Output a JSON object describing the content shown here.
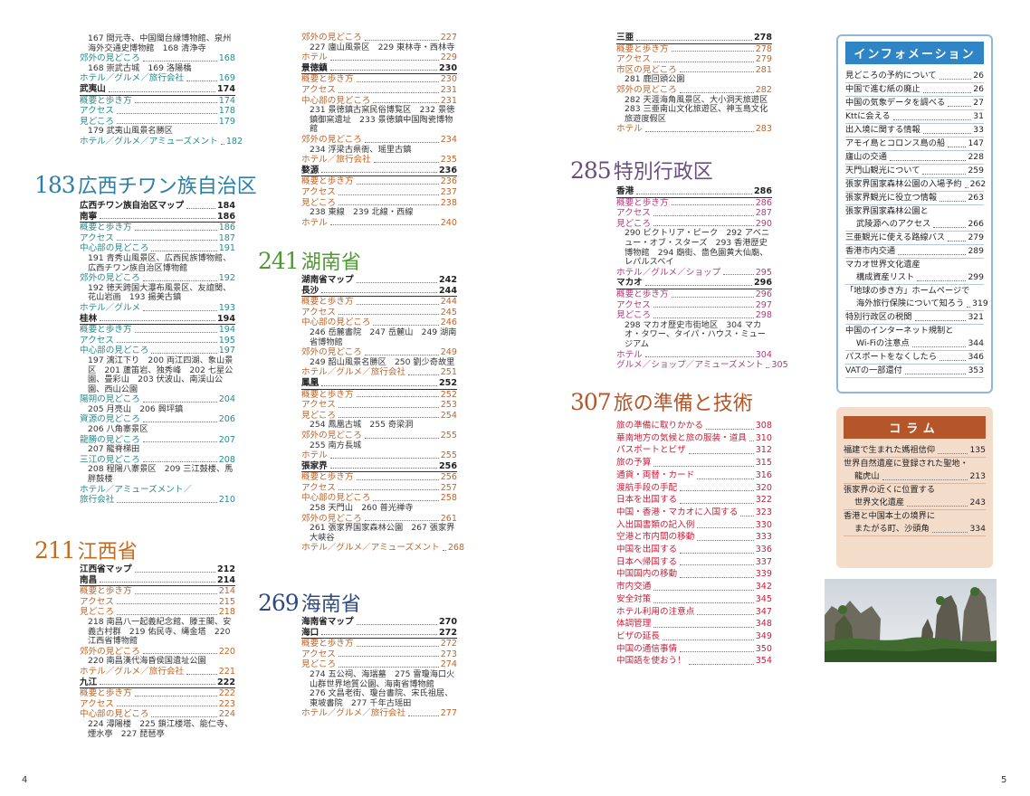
{
  "colA": [
    {
      "t": "167 開元寺、中国閩台縁博物館、泉州海外交通史博物館　168 清浄寺",
      "p": "",
      "c": "sub"
    },
    {
      "t": "郊外の見どころ",
      "p": "168",
      "c": "g"
    },
    {
      "t": "168 崇武古城　169 洛陽橋",
      "p": "",
      "c": "sub"
    },
    {
      "t": "ホテル／グルメ／旅行会社",
      "p": "169",
      "c": "g"
    },
    {
      "t": "武夷山",
      "p": "174",
      "c": "b rl"
    },
    {
      "t": "概要と歩き方",
      "p": "174",
      "c": "g"
    },
    {
      "t": "アクセス",
      "p": "178",
      "c": "g"
    },
    {
      "t": "見どころ",
      "p": "179",
      "c": "g"
    },
    {
      "t": "179 武夷山風景名勝区",
      "p": "",
      "c": "sub"
    },
    {
      "t": "ホテル／グルメ／アミューズメント",
      "p": "182",
      "c": "g"
    }
  ],
  "colB": [
    {
      "t": "広西チワン族自治区マップ",
      "p": "184",
      "c": "b"
    },
    {
      "t": "南寧",
      "p": "186",
      "c": "b rl"
    },
    {
      "t": "概要と歩き方",
      "p": "186",
      "c": "g"
    },
    {
      "t": "アクセス",
      "p": "187",
      "c": "g"
    },
    {
      "t": "中心部の見どころ",
      "p": "191",
      "c": "g"
    },
    {
      "t": "191 青秀山風景区、広西民族博物館、広西チワン族自治区博物館",
      "p": "",
      "c": "sub"
    },
    {
      "t": "郊外の見どころ",
      "p": "192",
      "c": "g"
    },
    {
      "t": "192 徳天跨国大瀑布風景区、友誼関、花山岩画　193 揚美古鎮",
      "p": "",
      "c": "sub"
    },
    {
      "t": "ホテル／グルメ",
      "p": "193",
      "c": "g"
    },
    {
      "t": "桂林",
      "p": "194",
      "c": "b rl"
    },
    {
      "t": "概要と歩き方",
      "p": "194",
      "c": "g"
    },
    {
      "t": "アクセス",
      "p": "195",
      "c": "g"
    },
    {
      "t": "中心部の見どころ",
      "p": "197",
      "c": "g"
    },
    {
      "t": "197 漓江下り　200 両江四湖、象山景区　201 蘆笛岩、独秀峰　202 七星公園、畳彩山　203 伏波山、南渓山公園、西山公園",
      "p": "",
      "c": "sub"
    },
    {
      "t": "陽朔の見どころ",
      "p": "204",
      "c": "g"
    },
    {
      "t": "205 月亮山　206 興坪鎮",
      "p": "",
      "c": "sub"
    },
    {
      "t": "資源の見どころ",
      "p": "206",
      "c": "g"
    },
    {
      "t": "206 八角寨景区",
      "p": "",
      "c": "sub"
    },
    {
      "t": "龍勝の見どころ",
      "p": "207",
      "c": "g"
    },
    {
      "t": "207 龍脊梯田",
      "p": "",
      "c": "sub"
    },
    {
      "t": "三江の見どころ",
      "p": "208",
      "c": "g"
    },
    {
      "t": "208 程陽八寨景区　209 三江鼓楼、馬胖鼓楼",
      "p": "",
      "c": "sub"
    },
    {
      "t": "ホテル／アミューズメント／",
      "p": "",
      "c": "g"
    },
    {
      "t": "旅行会社",
      "p": "210",
      "c": "g ind"
    }
  ],
  "colC": [
    {
      "t": "江西省マップ",
      "p": "212",
      "c": "b"
    },
    {
      "t": "南昌",
      "p": "214",
      "c": "b rl"
    },
    {
      "t": "概要と歩き方",
      "p": "214",
      "c": "o"
    },
    {
      "t": "アクセス",
      "p": "215",
      "c": "o"
    },
    {
      "t": "見どころ",
      "p": "218",
      "c": "o"
    },
    {
      "t": "218 南昌八一起義紀念館、滕王閣、安義古村群　219 佑民寺、縄金塔　220 江西省博物館",
      "p": "",
      "c": "sub"
    },
    {
      "t": "郊外の見どころ",
      "p": "220",
      "c": "o"
    },
    {
      "t": "220 南昌漢代海昏侯国遺址公園",
      "p": "",
      "c": "sub"
    },
    {
      "t": "ホテル／グルメ／旅行会社",
      "p": "221",
      "c": "o"
    },
    {
      "t": "九江",
      "p": "222",
      "c": "b rl"
    },
    {
      "t": "概要と歩き方",
      "p": "222",
      "c": "o"
    },
    {
      "t": "アクセス",
      "p": "223",
      "c": "o"
    },
    {
      "t": "中心部の見どころ",
      "p": "224",
      "c": "o"
    },
    {
      "t": "224 潯陽楼　225 鎖江楼塔、能仁寺、煙水亭　227 琵琶亭",
      "p": "",
      "c": "sub"
    }
  ],
  "colD": [
    {
      "t": "郊外の見どころ",
      "p": "227",
      "c": "o"
    },
    {
      "t": "227 廬山風景区　229 東林寺・西林寺",
      "p": "",
      "c": "sub"
    },
    {
      "t": "ホテル",
      "p": "229",
      "c": "o"
    },
    {
      "t": "景徳鎮",
      "p": "230",
      "c": "b rl"
    },
    {
      "t": "概要と歩き方",
      "p": "230",
      "c": "o"
    },
    {
      "t": "アクセス",
      "p": "231",
      "c": "o"
    },
    {
      "t": "中心部の見どころ",
      "p": "231",
      "c": "o"
    },
    {
      "t": "231 景徳鎮古窯民俗博覧区　232 景徳鎮御窯遺址　233 景徳鎮中国陶瓷博物館",
      "p": "",
      "c": "sub"
    },
    {
      "t": "郊外の見どころ",
      "p": "234",
      "c": "o"
    },
    {
      "t": "234 浮梁古県衙、瑶里古鎮",
      "p": "",
      "c": "sub"
    },
    {
      "t": "ホテル／旅行会社",
      "p": "235",
      "c": "o"
    },
    {
      "t": "婺源",
      "p": "236",
      "c": "b rl"
    },
    {
      "t": "概要と歩き方",
      "p": "236",
      "c": "o"
    },
    {
      "t": "アクセス",
      "p": "237",
      "c": "o"
    },
    {
      "t": "見どころ",
      "p": "238",
      "c": "o"
    },
    {
      "t": "238 東線　239 北線・西線",
      "p": "",
      "c": "sub"
    },
    {
      "t": "ホテル",
      "p": "240",
      "c": "o"
    }
  ],
  "colE": [
    {
      "t": "湖南省マップ",
      "p": "242",
      "c": "b"
    },
    {
      "t": "長沙",
      "p": "244",
      "c": "b rl"
    },
    {
      "t": "概要と歩き方",
      "p": "244",
      "c": "o"
    },
    {
      "t": "アクセス",
      "p": "245",
      "c": "o"
    },
    {
      "t": "中心部の見どころ",
      "p": "246",
      "c": "o"
    },
    {
      "t": "246 岳麓書院　247 岳麓山　249 湖南省博物館",
      "p": "",
      "c": "sub"
    },
    {
      "t": "郊外の見どころ",
      "p": "249",
      "c": "o"
    },
    {
      "t": "249 韶山風景名勝区　250 劉少奇故里",
      "p": "",
      "c": "sub"
    },
    {
      "t": "ホテル／グルメ／旅行会社",
      "p": "251",
      "c": "o"
    },
    {
      "t": "鳳凰",
      "p": "252",
      "c": "b rl"
    },
    {
      "t": "概要と歩き方",
      "p": "252",
      "c": "o"
    },
    {
      "t": "アクセス",
      "p": "253",
      "c": "o"
    },
    {
      "t": "見どころ",
      "p": "254",
      "c": "o"
    },
    {
      "t": "254 鳳凰古城　255 奇梁洞",
      "p": "",
      "c": "sub"
    },
    {
      "t": "郊外の見どころ",
      "p": "255",
      "c": "o"
    },
    {
      "t": "255 南方長城",
      "p": "",
      "c": "sub"
    },
    {
      "t": "ホテル",
      "p": "255",
      "c": "o"
    },
    {
      "t": "張家界",
      "p": "256",
      "c": "b rl"
    },
    {
      "t": "概要と歩き方",
      "p": "256",
      "c": "o"
    },
    {
      "t": "アクセス",
      "p": "257",
      "c": "o"
    },
    {
      "t": "中心部の見どころ",
      "p": "258",
      "c": "o"
    },
    {
      "t": "258 天門山　260 普光禅寺",
      "p": "",
      "c": "sub"
    },
    {
      "t": "郊外の見どころ",
      "p": "261",
      "c": "o"
    },
    {
      "t": "261 張家界国家森林公園　267 張家界大峡谷",
      "p": "",
      "c": "sub"
    },
    {
      "t": "ホテル／グルメ／アミューズメント",
      "p": "268",
      "c": "o"
    }
  ],
  "colF": [
    {
      "t": "海南省マップ",
      "p": "270",
      "c": "b"
    },
    {
      "t": "海口",
      "p": "272",
      "c": "b rl"
    },
    {
      "t": "概要と歩き方",
      "p": "272",
      "c": "o"
    },
    {
      "t": "アクセス",
      "p": "273",
      "c": "o"
    },
    {
      "t": "見どころ",
      "p": "274",
      "c": "o"
    },
    {
      "t": "274 五公祠、海瑞墓　275 雷瓊海口火山群世界地質公園、海南省博物館",
      "p": "",
      "c": "sub"
    },
    {
      "t": "276 文昌老街、瓊台書院、宋氏祖居、東坡書院　277 千年古瑶田",
      "p": "",
      "c": "sub"
    },
    {
      "t": "ホテル／グルメ／旅行会社",
      "p": "277",
      "c": "o"
    }
  ],
  "colG": [
    {
      "t": "三亜",
      "p": "278",
      "c": "b rl"
    },
    {
      "t": "概要と歩き方",
      "p": "278",
      "c": "o"
    },
    {
      "t": "アクセス",
      "p": "279",
      "c": "o"
    },
    {
      "t": "市区の見どころ",
      "p": "281",
      "c": "o"
    },
    {
      "t": "281 鹿回頭公園",
      "p": "",
      "c": "sub"
    },
    {
      "t": "郊外の見どころ",
      "p": "282",
      "c": "o"
    },
    {
      "t": "282 天涯海角風景区、大小洞天旅遊区　283 三亜南山文化旅遊区、神玉島文化旅遊度假区",
      "p": "",
      "c": "sub"
    },
    {
      "t": "ホテル",
      "p": "283",
      "c": "o"
    }
  ],
  "colH": [
    {
      "t": "香港",
      "p": "286",
      "c": "b rl"
    },
    {
      "t": "概要と歩き方",
      "p": "286",
      "c": "mg"
    },
    {
      "t": "アクセス",
      "p": "287",
      "c": "mg"
    },
    {
      "t": "見どころ",
      "p": "290",
      "c": "mg"
    },
    {
      "t": "290 ビクトリア・ピーク　292 アベニュー・オブ・スターズ　293 香港歴史博物館　294 廟街、嗇色園黄大仙廟、レパルスベイ",
      "p": "",
      "c": "sub"
    },
    {
      "t": "ホテル／グルメ／ショップ",
      "p": "295",
      "c": "mg"
    },
    {
      "t": "マカオ",
      "p": "296",
      "c": "b rl"
    },
    {
      "t": "概要と歩き方",
      "p": "296",
      "c": "mg"
    },
    {
      "t": "アクセス",
      "p": "297",
      "c": "mg"
    },
    {
      "t": "見どころ",
      "p": "298",
      "c": "mg"
    },
    {
      "t": "298 マカオ歴史市街地区　304 マカオ・タワー、タイパ・ハウス・ミュージアム",
      "p": "",
      "c": "sub"
    },
    {
      "t": "ホテル",
      "p": "304",
      "c": "mg"
    },
    {
      "t": "グルメ／ショップ／アミューズメント",
      "p": "305",
      "c": "mg"
    }
  ],
  "colI": [
    {
      "t": "旅の準備に取りかかる",
      "p": "308",
      "c": "red"
    },
    {
      "t": "華南地方の気候と旅の服装・道具",
      "p": "310",
      "c": "red"
    },
    {
      "t": "パスポートとビザ",
      "p": "312",
      "c": "red"
    },
    {
      "t": "旅の予算",
      "p": "315",
      "c": "red"
    },
    {
      "t": "通貨・両替・カード",
      "p": "316",
      "c": "red"
    },
    {
      "t": "渡航手段の手配",
      "p": "320",
      "c": "red"
    },
    {
      "t": "日本を出国する",
      "p": "322",
      "c": "red"
    },
    {
      "t": "中国・香港・マカオに入国する",
      "p": "323",
      "c": "red"
    },
    {
      "t": "入出国書類の記入例",
      "p": "330",
      "c": "red"
    },
    {
      "t": "空港と市内間の移動",
      "p": "333",
      "c": "red"
    },
    {
      "t": "中国を出国する",
      "p": "336",
      "c": "red"
    },
    {
      "t": "日本へ帰国する",
      "p": "337",
      "c": "red"
    },
    {
      "t": "中国国内の移動",
      "p": "339",
      "c": "red"
    },
    {
      "t": "市内交通",
      "p": "342",
      "c": "red"
    },
    {
      "t": "安全対策",
      "p": "345",
      "c": "red"
    },
    {
      "t": "ホテル利用の注意点",
      "p": "347",
      "c": "red"
    },
    {
      "t": "体調管理",
      "p": "348",
      "c": "red"
    },
    {
      "t": "ビザの延長",
      "p": "349",
      "c": "red"
    },
    {
      "t": "中国の通信事情",
      "p": "350",
      "c": "red"
    },
    {
      "t": "中国語を使おう！",
      "p": "354",
      "c": "red"
    }
  ],
  "sections": {
    "s183": {
      "n": "183",
      "h": "広西チワン族自治区"
    },
    "s211": {
      "n": "211",
      "h": "江西省"
    },
    "s241": {
      "n": "241",
      "h": "湖南省"
    },
    "s269": {
      "n": "269",
      "h": "海南省"
    },
    "s285": {
      "n": "285",
      "h": "特別行政区"
    },
    "s307": {
      "n": "307",
      "h": "旅の準備と技術"
    }
  },
  "info": {
    "title": "インフォメーション",
    "items": [
      {
        "t": "見どころの予約について",
        "p": "26"
      },
      {
        "t": "中国で進む紙の廃止",
        "p": "26"
      },
      {
        "t": "中国の気象データを調べる",
        "p": "27"
      },
      {
        "t": "Kttに会える",
        "p": "31"
      },
      {
        "t": "出入境に関する情報",
        "p": "33"
      },
      {
        "t": "アモイ島とコロンス島の船",
        "p": "147"
      },
      {
        "t": "廬山の交通",
        "p": "228"
      },
      {
        "t": "天門山観光について",
        "p": "259"
      },
      {
        "t": "張家界国家森林公園の入場予約",
        "p": "262"
      },
      {
        "t": "張家界観光に役立つ情報",
        "p": "263"
      },
      {
        "t": "張家界国家森林公園と",
        "p": ""
      },
      {
        "t": "武陵源へのアクセス",
        "p": "266",
        "ind": true
      },
      {
        "t": "三亜観光に使える路線バス",
        "p": "279"
      },
      {
        "t": "香港市内交通",
        "p": "289"
      },
      {
        "t": "マカオ世界文化遺産",
        "p": ""
      },
      {
        "t": "構成資産リスト",
        "p": "299",
        "ind": true
      },
      {
        "t": "「地球の歩き方」ホームページで",
        "p": ""
      },
      {
        "t": "海外旅行保険について知ろう",
        "p": "319",
        "ind": true
      },
      {
        "t": "特別行政区の税関",
        "p": "321"
      },
      {
        "t": "中国のインターネット規制と",
        "p": ""
      },
      {
        "t": "Wi-Fiの注意点",
        "p": "344",
        "ind": true
      },
      {
        "t": "パスポートをなくしたら",
        "p": "346"
      },
      {
        "t": "VATの一部還付",
        "p": "353"
      }
    ]
  },
  "column": {
    "title": "コラム",
    "items": [
      {
        "t": "福建で生まれた媽祖信仰",
        "p": "135"
      },
      {
        "t": "世界自然遺産に登録された聖地・",
        "p": ""
      },
      {
        "t": "龍虎山",
        "p": "213",
        "ind": true
      },
      {
        "t": "張家界の近くに位置する",
        "p": ""
      },
      {
        "t": "世界文化遺産",
        "p": "243",
        "ind": true
      },
      {
        "t": "香港と中国本土の境界に",
        "p": ""
      },
      {
        "t": "またがる町、沙頭角",
        "p": "334",
        "ind": true
      }
    ]
  },
  "pages": {
    "left": "4",
    "right": "5"
  }
}
